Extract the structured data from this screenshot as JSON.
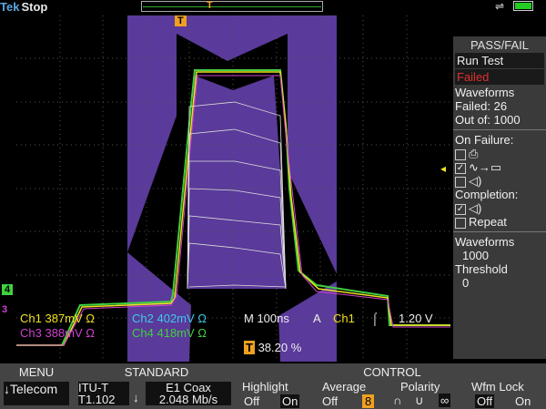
{
  "header": {
    "brand": "Tek",
    "status": "Stop"
  },
  "trigger_marker": "T",
  "panel": {
    "title": "PASS/FAIL",
    "run_test": "Run Test",
    "state": "Failed",
    "waveforms_label": "Waveforms",
    "failed_label": "Failed: 26",
    "outof_label": "Out of: 1000",
    "on_failure": "On Failure:",
    "completion": "Completion:",
    "repeat": "Repeat",
    "wf_label": "Waveforms",
    "wf_value": "1000",
    "threshold_label": "Threshold",
    "threshold_value": "0"
  },
  "readouts": {
    "ch1": "Ch1",
    "ch1_val": "387mV Ω",
    "ch2": "Ch2",
    "ch2_val": "402mV Ω",
    "timebase": "M 100ns",
    "trig": "A",
    "trig_ch": "Ch1",
    "trig_level": "1.20 V",
    "ch3": "Ch3",
    "ch3_val": "388mV Ω",
    "ch4": "Ch4",
    "ch4_val": "418mV Ω",
    "trig_pos": "38.20 %"
  },
  "channel_markers": [
    "4",
    "3"
  ],
  "bottom": {
    "menu_label": "MENU",
    "menu_value": "Telecom",
    "standard_label": "STANDARD",
    "standard_code": "ITU-T",
    "standard_sub": "T1.102",
    "standard_signal": "E1 Coax",
    "standard_rate": "2.048 Mb/s",
    "control_label": "CONTROL",
    "highlight_label": "Highlight",
    "highlight_off": "Off",
    "highlight_on": "On",
    "average_label": "Average",
    "average_off": "Off",
    "average_n": "8",
    "polarity_label": "Polarity",
    "wfm_label": "Wfm Lock",
    "wfm_off": "Off",
    "wfm_on": "On"
  },
  "colors": {
    "ch1": "#f0e020",
    "ch2": "#40c8f0",
    "ch3": "#d040d0",
    "ch4": "#40d040",
    "mask": "#5a3a9a"
  }
}
